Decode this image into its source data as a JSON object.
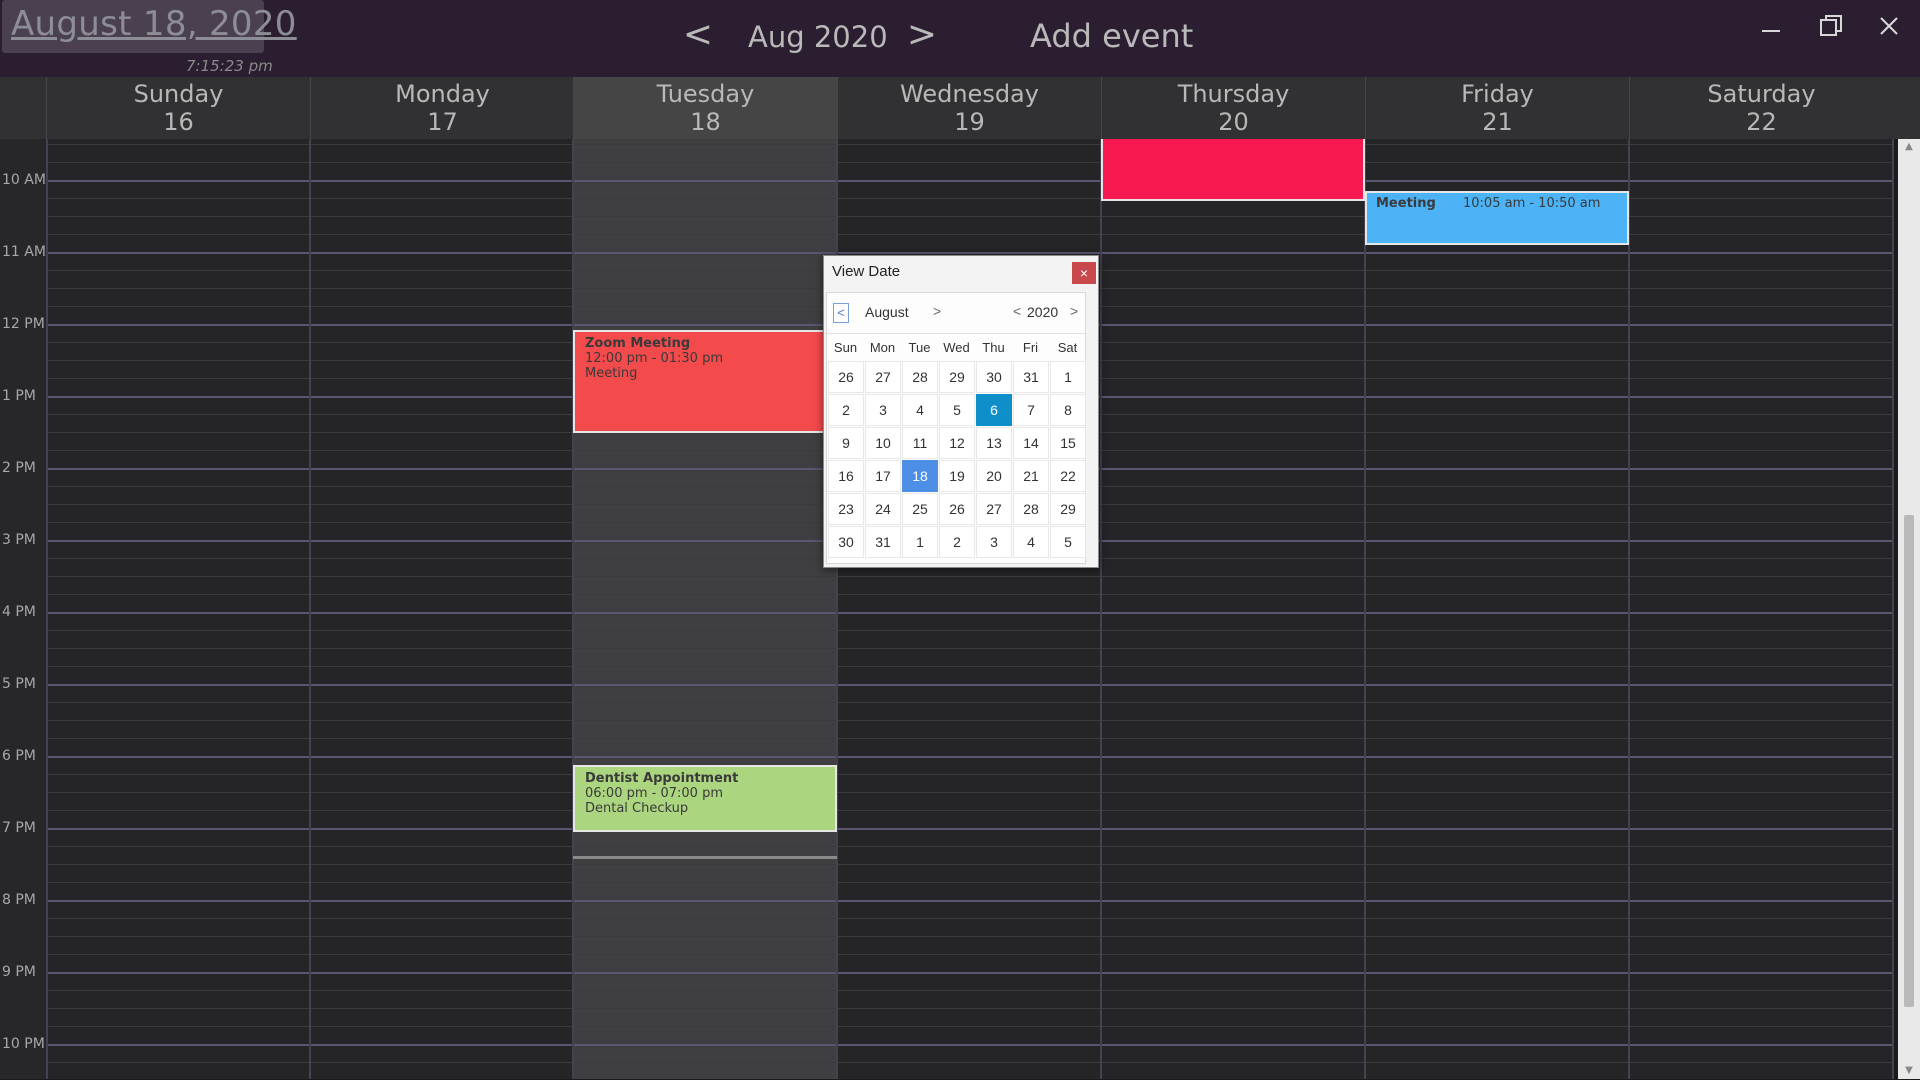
{
  "header": {
    "current_date": "August 18, 2020",
    "clock": "7:15:23 pm",
    "nav_prev": "<",
    "nav_next": ">",
    "month_label": "Aug 2020",
    "add_event": "Add event"
  },
  "window_controls": {
    "minimize_icon": "minimize-icon",
    "maximize_icon": "restore-icon",
    "close_icon": "close-icon"
  },
  "days": [
    {
      "name": "Sunday",
      "num": "16"
    },
    {
      "name": "Monday",
      "num": "17"
    },
    {
      "name": "Tuesday",
      "num": "18",
      "today": true
    },
    {
      "name": "Wednesday",
      "num": "19"
    },
    {
      "name": "Thursday",
      "num": "20"
    },
    {
      "name": "Friday",
      "num": "21"
    },
    {
      "name": "Saturday",
      "num": "22"
    }
  ],
  "time_labels": [
    "10 AM",
    "11 AM",
    "12 PM",
    "1 PM",
    "2 PM",
    "3 PM",
    "4 PM",
    "5 PM",
    "6 PM",
    "7 PM",
    "8 PM",
    "9 PM",
    "10 PM"
  ],
  "events": [
    {
      "title": "Zoom Meeting",
      "time": "12:00 pm - 01:30 pm",
      "description": "Meeting",
      "day": "Tuesday",
      "color": "#f34a4c"
    },
    {
      "title": "Dentist Appointment",
      "time": "06:00 pm - 07:00 pm",
      "description": "Dental Checkup",
      "day": "Tuesday",
      "color": "#acd580"
    },
    {
      "title": "",
      "time": "",
      "description": "",
      "day": "Thursday",
      "color": "#f7194f"
    },
    {
      "title": "Meeting",
      "time": "10:05 am - 10:50 am",
      "description": "",
      "day": "Friday",
      "color": "#4cb3f7"
    }
  ],
  "popup": {
    "title": "View Date",
    "close": "×",
    "month": "August",
    "year": "2020",
    "prev_icon": "<",
    "next_icon": ">",
    "weekdays": [
      "Sun",
      "Mon",
      "Tue",
      "Wed",
      "Thu",
      "Fri",
      "Sat"
    ],
    "weeks": [
      [
        "26",
        "27",
        "28",
        "29",
        "30",
        "31",
        "1"
      ],
      [
        "2",
        "3",
        "4",
        "5",
        "6",
        "7",
        "8"
      ],
      [
        "9",
        "10",
        "11",
        "12",
        "13",
        "14",
        "15"
      ],
      [
        "16",
        "17",
        "18",
        "19",
        "20",
        "21",
        "22"
      ],
      [
        "23",
        "24",
        "25",
        "26",
        "27",
        "28",
        "29"
      ],
      [
        "30",
        "31",
        "1",
        "2",
        "3",
        "4",
        "5"
      ]
    ],
    "selected_day": "6",
    "today_day": "18"
  }
}
